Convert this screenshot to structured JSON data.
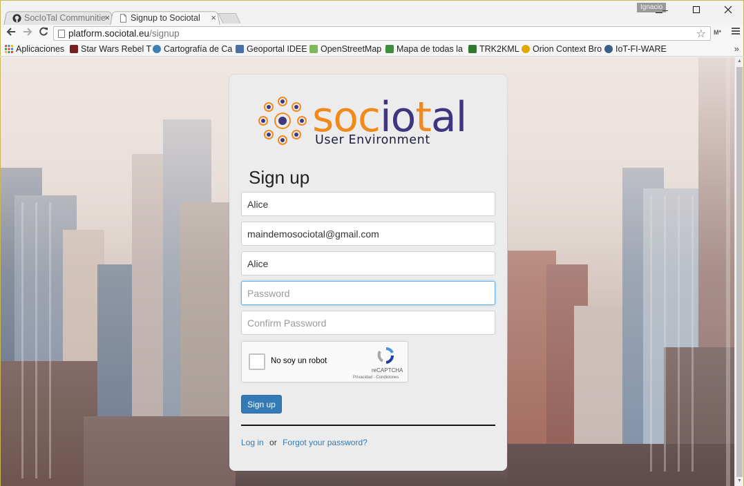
{
  "browser": {
    "tabs": [
      {
        "label": "SocIoTal Communitie",
        "active": false,
        "icon": "github-icon"
      },
      {
        "label": "Signup to Sociotal",
        "active": true,
        "icon": "page-icon"
      }
    ],
    "tab_close": "×",
    "profile_name": "Ignacio",
    "window_controls": {
      "minimize": "—",
      "maximize": "☐",
      "close": "✕"
    },
    "url_host": "platform.sociotal.eu",
    "url_path": "/signup",
    "ext_label": "M*"
  },
  "bookmarks": [
    {
      "label": "Aplicaciones",
      "icon": "apps-grid-icon",
      "color": "#d9402b"
    },
    {
      "label": "Star Wars Rebel T",
      "icon": "starwars-icon",
      "color": "#7a1f1f"
    },
    {
      "label": "Cartografía de Ca",
      "icon": "cartografia-icon",
      "color": "#3d7fb5"
    },
    {
      "label": "Geoportal IDEE",
      "icon": "geoportal-icon",
      "color": "#4a6fa5"
    },
    {
      "label": "OpenStreetMap",
      "icon": "openstreetmap-icon",
      "color": "#7eb85a"
    },
    {
      "label": "Mapa de todas la",
      "icon": "mapa-icon",
      "color": "#3f8f3f"
    },
    {
      "label": "TRK2KML",
      "icon": "trk2kml-icon",
      "color": "#2d7a2d"
    },
    {
      "label": "Orion Context Bro",
      "icon": "orion-icon",
      "color": "#e0a800"
    },
    {
      "label": "IoT-FI-WARE",
      "icon": "fiware-icon",
      "color": "#3b5f8a"
    }
  ],
  "bookmarks_more": "»",
  "signup": {
    "logo_text_orange": "soc",
    "logo_text_blue": "io",
    "logo_text_orange2": "t",
    "logo_text_blue2": "al",
    "logo_subtitle": "User Environment",
    "heading": "Sign up",
    "fields": {
      "name_value": "Alice",
      "email_value": "maindemosociotal@gmail.com",
      "username_value": "Alice",
      "password_placeholder": "Password",
      "confirm_placeholder": "Confirm Password"
    },
    "captcha": {
      "label": "No soy un robot",
      "brand": "reCAPTCHA",
      "links": "Privacidad - Condiciones"
    },
    "submit_label": "Sign up",
    "login_link": "Log in",
    "or_text": "or",
    "forgot_link": "Forgot your password?"
  },
  "colors": {
    "primary_button": "#337ab7",
    "logo_orange": "#f08a1c",
    "logo_blue": "#3f3680",
    "focus_border": "#66afe9"
  }
}
